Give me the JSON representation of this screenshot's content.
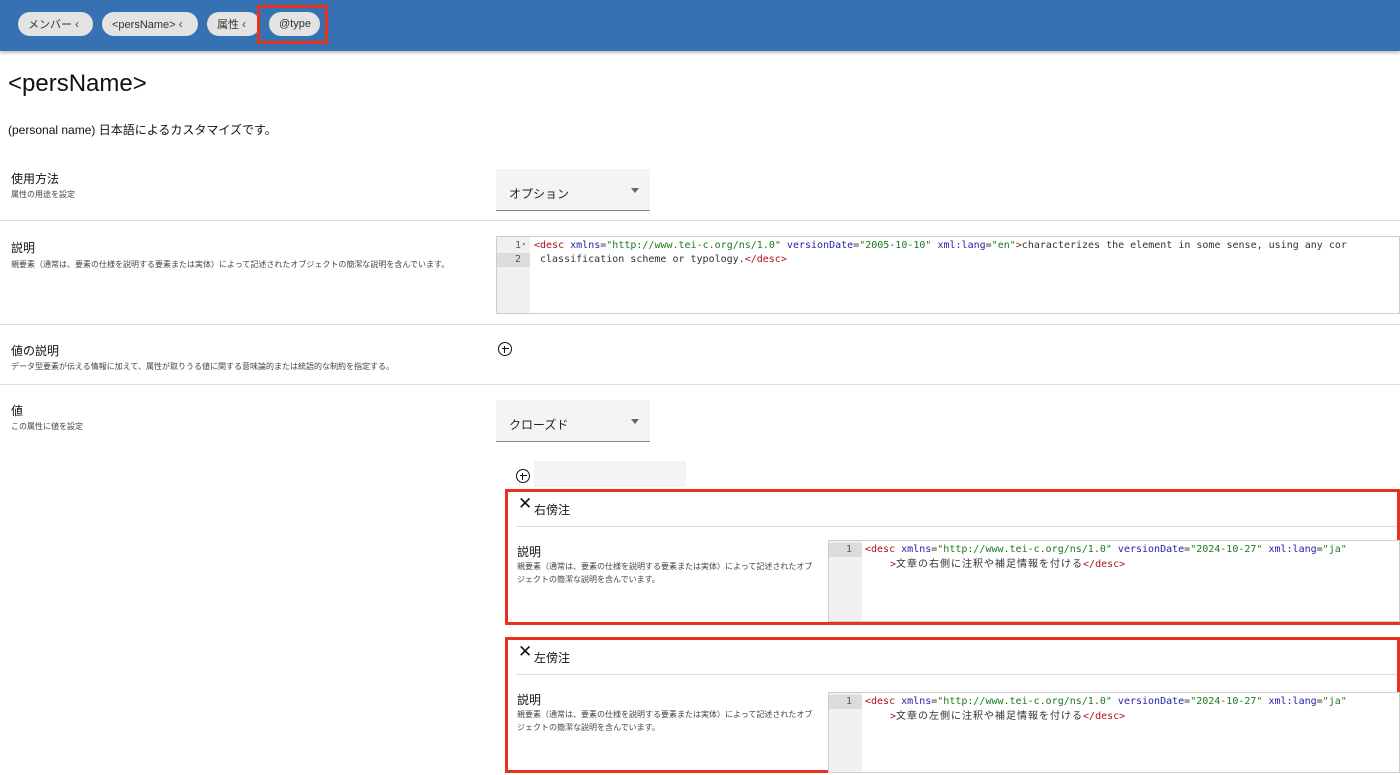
{
  "breadcrumbs": [
    {
      "label": "メンバー"
    },
    {
      "label": "<persName>"
    },
    {
      "label": "属性"
    },
    {
      "label": "@type"
    }
  ],
  "page": {
    "title": "<persName>",
    "subtitle": "(personal name) 日本語によるカスタマイズです。"
  },
  "usage": {
    "label": "使用方法",
    "hint": "属性の用途を設定",
    "selected": "オプション"
  },
  "description": {
    "label": "説明",
    "hint": "親要素（通常は、要素の仕様を説明する要素または実体）によって記述されたオブジェクトの簡潔な説明を含んでいます。",
    "lines": [
      "1",
      "2"
    ],
    "code": {
      "tag_open": "<desc",
      "attr_xmlns": "xmlns",
      "val_xmlns": "\"http://www.tei-c.org/ns/1.0\"",
      "attr_version": "versionDate",
      "val_version": "\"2005-10-10\"",
      "attr_lang": "xml:lang",
      "val_lang": "\"en\"",
      "text_1": "characterizes the element in some sense, using any cor",
      "text_2": "classification scheme or typology.",
      "tag_close": "</desc>"
    }
  },
  "value_description": {
    "label": "値の説明",
    "hint": "データ型要素が伝える情報に加えて、属性が取りうる値に関する意味論的または統語的な制約を指定する。"
  },
  "values": {
    "label": "値",
    "hint": "この属性に値を設定",
    "selected": "クローズド",
    "items": [
      {
        "title": "右傍注",
        "desc_label": "説明",
        "desc_hint": "親要素（通常は、要素の仕様を説明する要素または実体）によって記述されたオブジェクトの簡潔な説明を含んでいます。",
        "line": "1",
        "code": {
          "tag_open": "<desc",
          "attr_xmlns": "xmlns",
          "val_xmlns": "\"http://www.tei-c.org/ns/1.0\"",
          "attr_version": "versionDate",
          "val_version": "\"2024-10-27\"",
          "attr_lang": "xml:lang",
          "val_lang": "\"ja\"",
          "close_bracket": ">",
          "text": "文章の右側に注釈や補足情報を付ける",
          "tag_close": "</desc>"
        }
      },
      {
        "title": "左傍注",
        "desc_label": "説明",
        "desc_hint": "親要素（通常は、要素の仕様を説明する要素または実体）によって記述されたオブジェクトの簡潔な説明を含んでいます。",
        "line": "1",
        "code": {
          "tag_open": "<desc",
          "attr_xmlns": "xmlns",
          "val_xmlns": "\"http://www.tei-c.org/ns/1.0\"",
          "attr_version": "versionDate",
          "val_version": "\"2024-10-27\"",
          "attr_lang": "xml:lang",
          "val_lang": "\"ja\"",
          "close_bracket": ">",
          "text": "文章の左側に注釈や補足情報を付ける",
          "tag_close": "</desc>"
        }
      }
    ]
  },
  "icons": {
    "breadcrumb_back": "chevron-left-icon",
    "add": "add-circle-icon",
    "remove": "close-icon",
    "dropdown": "caret-down-icon"
  },
  "colors": {
    "topbar": "#3672b1",
    "highlight": "#e8321d",
    "xml_tag": "#aa1111",
    "xml_attr": "#2222aa",
    "xml_value": "#1a7a1a"
  }
}
